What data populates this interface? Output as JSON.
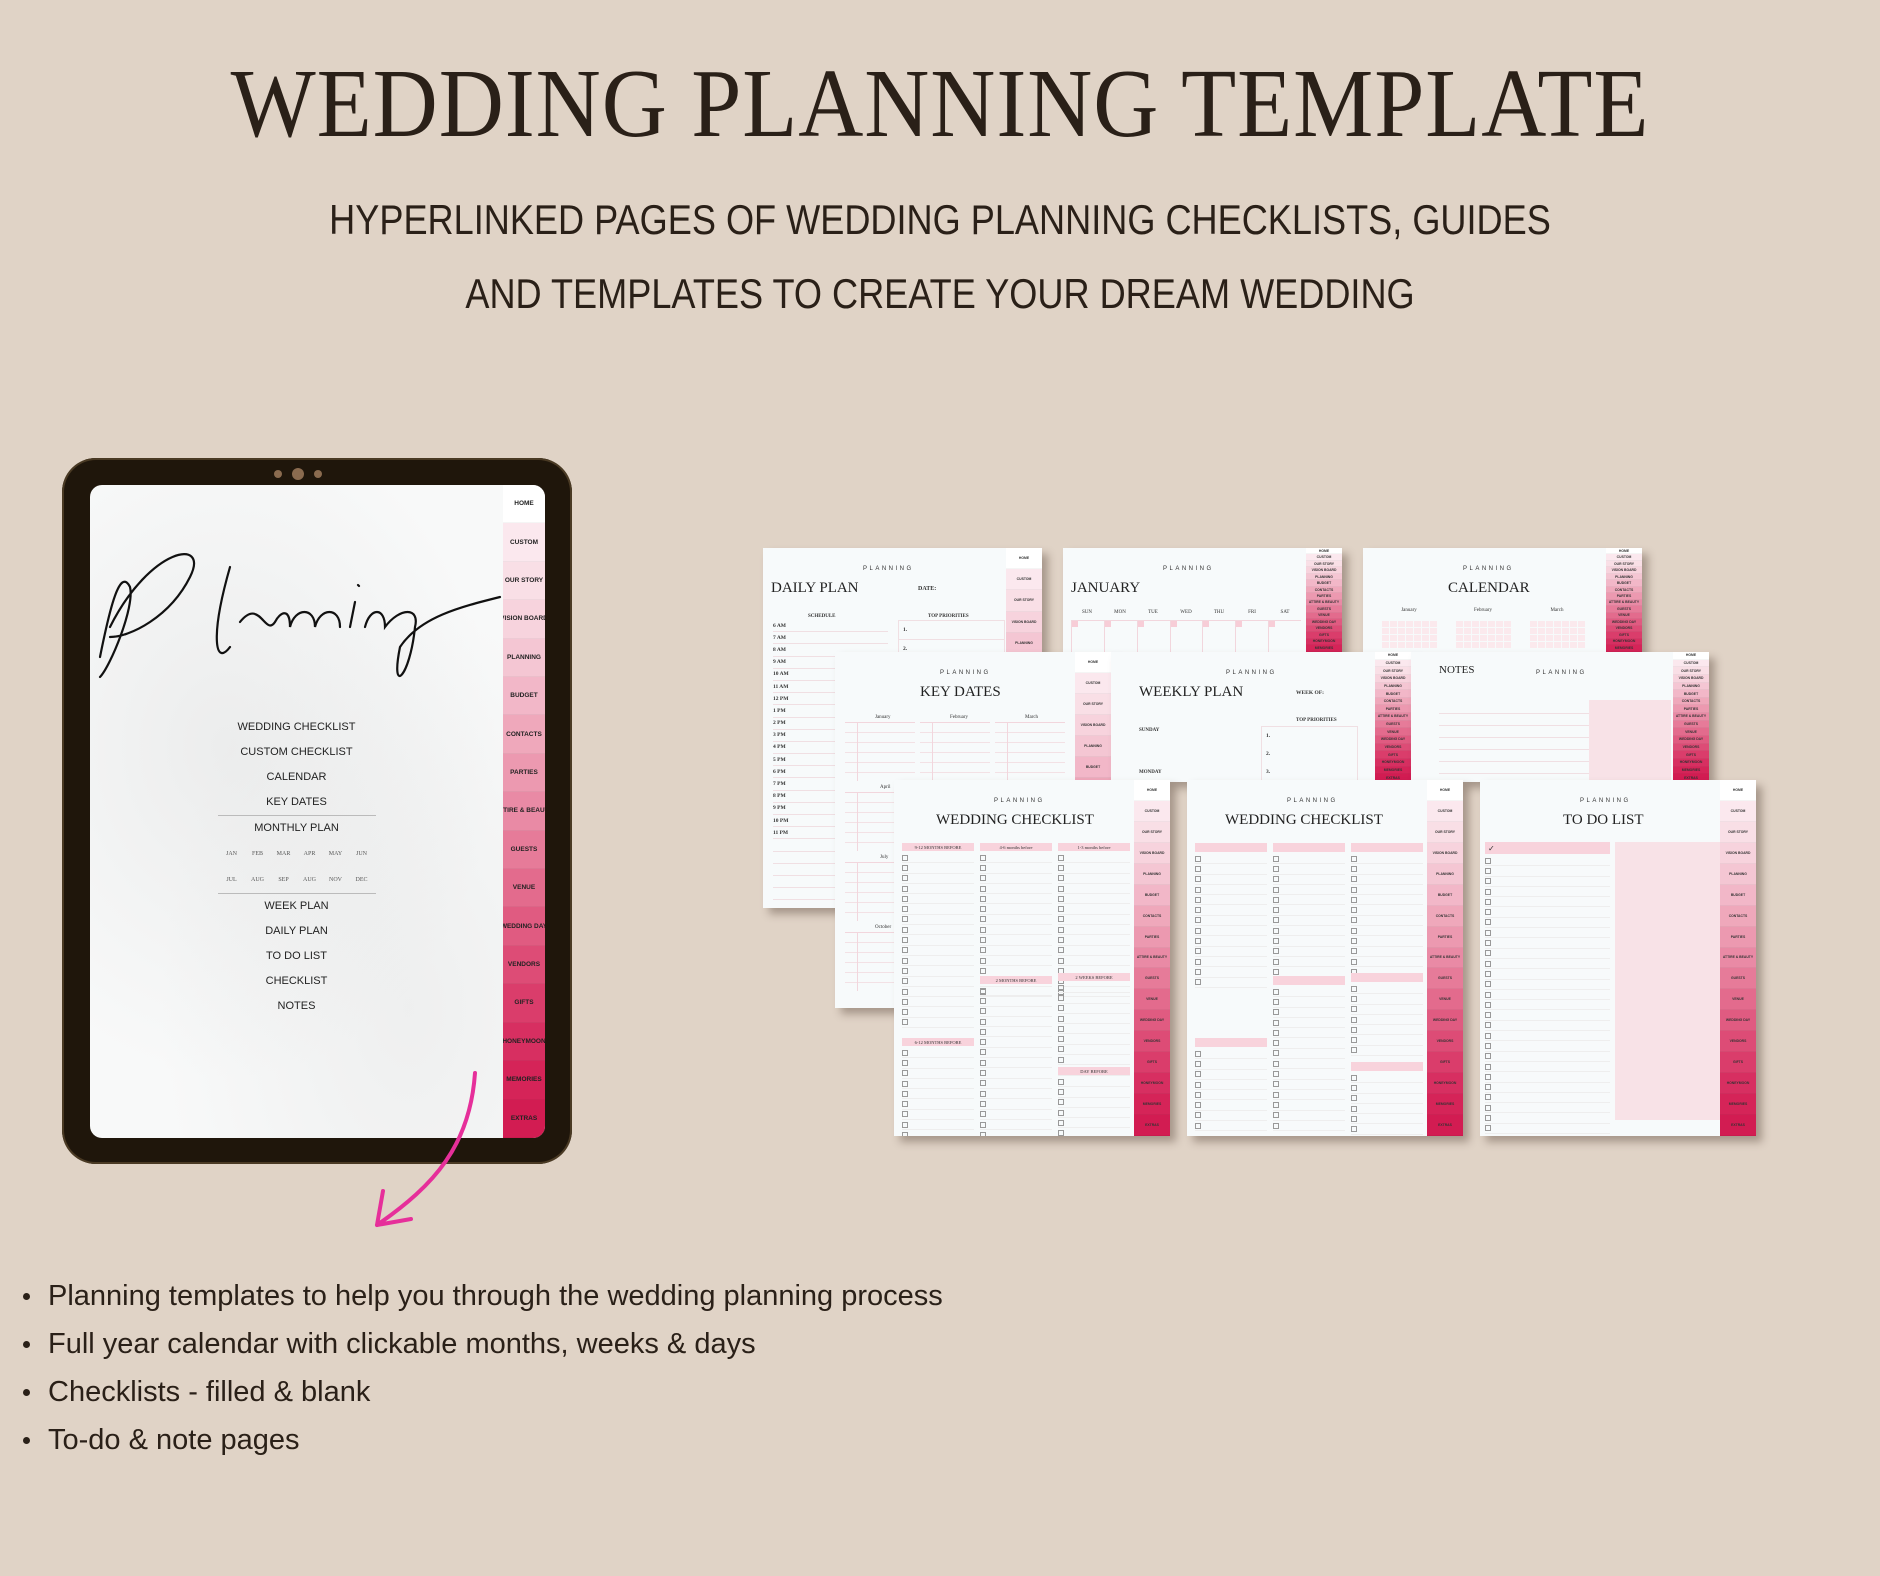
{
  "header": {
    "title": "WEDDING PLANNING TEMPLATE",
    "subtitle_line1": "HYPERLINKED PAGES OF WEDDING PLANNING CHECKLISTS, GUIDES",
    "subtitle_line2": "AND TEMPLATES TO CREATE YOUR DREAM WEDDING"
  },
  "tablet": {
    "script_title": "Planning",
    "menu": [
      "WEDDING CHECKLIST",
      "CUSTOM CHECKLIST",
      "CALENDAR",
      "KEY DATES",
      "MONTHLY PLAN",
      "WEEK PLAN",
      "DAILY PLAN",
      "TO DO LIST",
      "CHECKLIST",
      "NOTES"
    ],
    "months_row1": [
      "JAN",
      "FEB",
      "MAR",
      "APR",
      "MAY",
      "JUN"
    ],
    "months_row2": [
      "JUL",
      "AUG",
      "SEP",
      "AUG",
      "NOV",
      "DEC"
    ],
    "tabs": [
      "HOME",
      "CUSTOM",
      "OUR STORY",
      "VISION BOARD",
      "PLANNING",
      "BUDGET",
      "CONTACTS",
      "PARTIES",
      "ATTIRE & BEAUTY",
      "GUESTS",
      "VENUE",
      "WEDDING DAY",
      "VENDORS",
      "GIFTS",
      "HONEYMOON",
      "MEMORIES",
      "EXTRAS"
    ],
    "tab_colors": [
      "#ffffff",
      "#fbe8ee",
      "#f9dfe6",
      "#f7d3dd",
      "#f4c6d3",
      "#f2b7c8",
      "#efa8bb",
      "#ec99b0",
      "#e98aa5",
      "#e67b99",
      "#e36b8d",
      "#e05b81",
      "#dd4c76",
      "#da3d6b",
      "#d72f61",
      "#d52458",
      "#d21c52"
    ]
  },
  "arrow_color": "#e62f9a",
  "bullets": [
    "Planning templates to help you through the wedding planning process",
    "Full year calendar with clickable months, weeks & days",
    "Checklists - filled & blank",
    "To-do & note pages"
  ],
  "pages": {
    "kicker": "PLANNING",
    "side_tabs": [
      "HOME",
      "CUSTOM",
      "OUR STORY",
      "VISION BOARD",
      "PLANNING",
      "BUDGET",
      "CONTACTS",
      "PARTIES",
      "ATTIRE & BEAUTY",
      "GUESTS",
      "VENUE",
      "WEDDING DAY",
      "VENDORS",
      "GIFTS",
      "HONEYMOON",
      "MEMORIES",
      "EXTRAS"
    ],
    "daily": {
      "title": "DAILY PLAN",
      "date_label": "DATE:",
      "schedule_label": "SCHEDULE",
      "priorities_label": "TOP PRIORITIES",
      "priorities": [
        "1.",
        "2."
      ],
      "hours": [
        "6 AM",
        "7 AM",
        "8 AM",
        "9 AM",
        "10 AM",
        "11 AM",
        "12 PM",
        "1 PM",
        "2 PM",
        "3 PM",
        "4 PM",
        "5 PM",
        "6 PM",
        "7 PM",
        "8 PM",
        "9 PM",
        "10 PM",
        "11 PM"
      ]
    },
    "january": {
      "title": "JANUARY",
      "days": [
        "SUN",
        "MON",
        "TUE",
        "WED",
        "THU",
        "FRI",
        "SAT"
      ]
    },
    "calendar": {
      "title": "CALENDAR",
      "months": [
        "January",
        "February",
        "March"
      ]
    },
    "key_dates": {
      "title": "KEY DATES",
      "months": [
        "January",
        "February",
        "March",
        "April",
        "July",
        "October"
      ]
    },
    "weekly": {
      "title": "WEEKLY PLAN",
      "week_of_label": "WEEK OF:",
      "priorities_label": "TOP PRIORITIES",
      "priorities": [
        "1.",
        "2.",
        "3."
      ],
      "days": [
        "SUNDAY",
        "MONDAY"
      ]
    },
    "notes": {
      "title": "NOTES"
    },
    "checklist_filled": {
      "title": "WEDDING CHECKLIST",
      "sections": [
        "9-12 MONTHS BEFORE",
        "4-6 months before",
        "1-3 months before",
        "6-12 MONTHS BEFORE",
        "2 MONTHS BEFORE",
        "2 WEEKS BEFORE",
        "DAY BEFORE"
      ]
    },
    "checklist_blank": {
      "title": "WEDDING CHECKLIST"
    },
    "todo": {
      "title": "TO DO LIST",
      "check_mark": "✓"
    }
  }
}
